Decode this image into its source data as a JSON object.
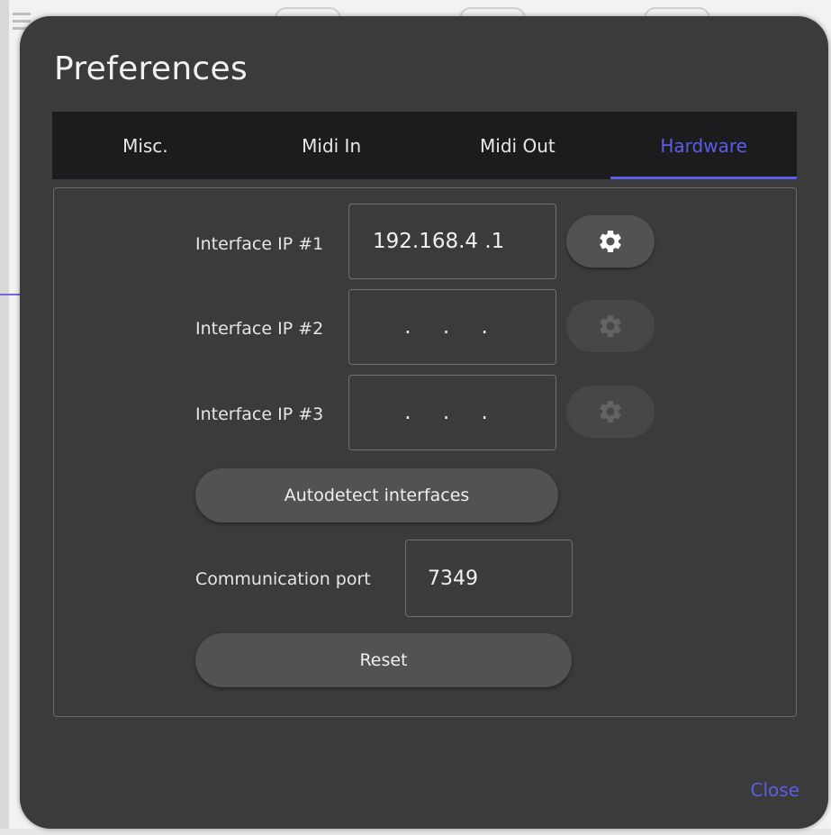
{
  "dialog": {
    "title": "Preferences",
    "close_label": "Close"
  },
  "tabs": [
    {
      "label": "Misc.",
      "active": false
    },
    {
      "label": "Midi In",
      "active": false
    },
    {
      "label": "Midi Out",
      "active": false
    },
    {
      "label": "Hardware",
      "active": true
    }
  ],
  "hardware": {
    "interfaces": [
      {
        "label": "Interface IP #1",
        "value": "192.168.4  .1",
        "gear_enabled": true
      },
      {
        "label": "Interface IP #2",
        "value": ". . .",
        "gear_enabled": false
      },
      {
        "label": "Interface IP #3",
        "value": ". . .",
        "gear_enabled": false
      }
    ],
    "autodetect_label": "Autodetect interfaces",
    "port_label": "Communication port",
    "port_value": "7349",
    "reset_label": "Reset"
  },
  "colors": {
    "accent": "#5a5ee6",
    "modal_bg": "#3b3b3b",
    "tabbar_bg": "#1c1c1e",
    "button_bg": "#525252"
  },
  "icons": {
    "gear": "gear-icon"
  }
}
